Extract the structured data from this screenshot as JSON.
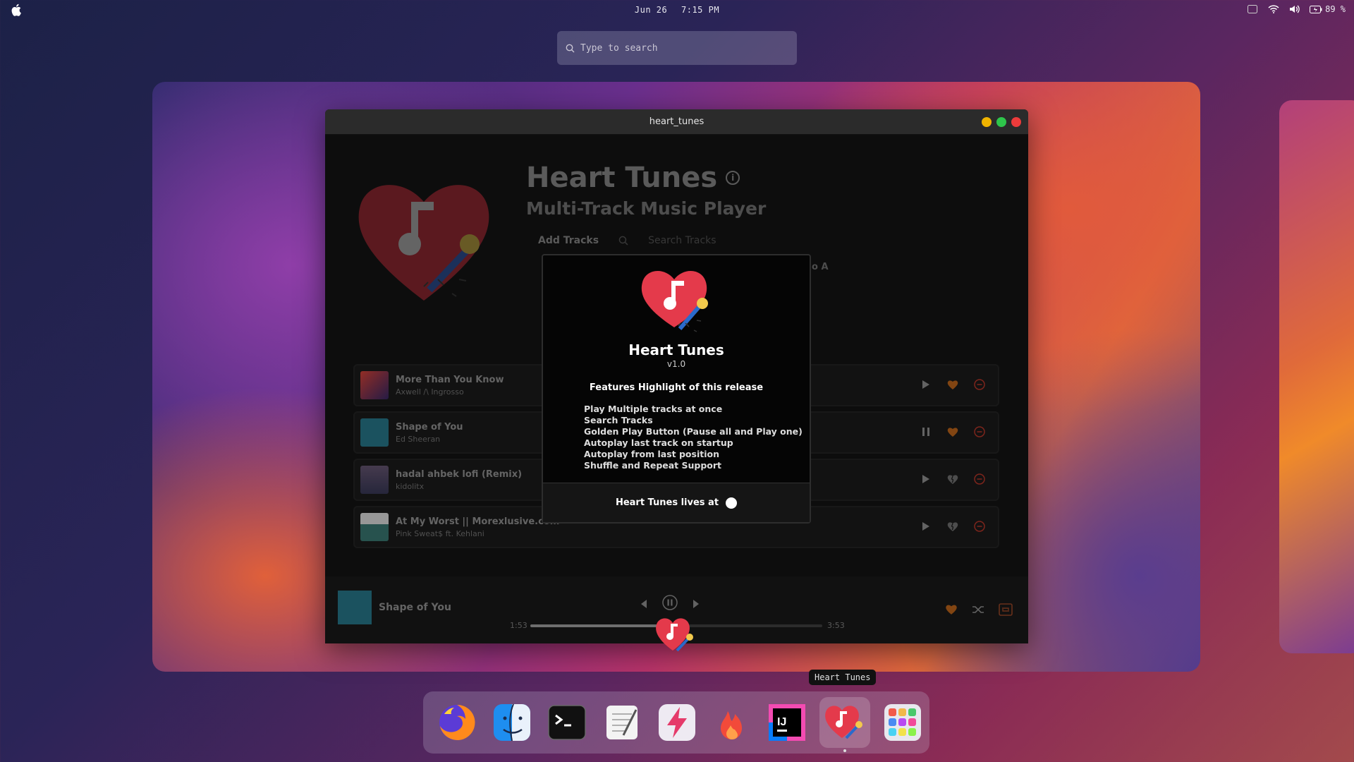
{
  "topbar": {
    "date": "Jun 26",
    "time": "7:15 PM",
    "battery": "89 %"
  },
  "search": {
    "placeholder": "Type to search"
  },
  "window": {
    "title": "heart_tunes",
    "buttons": {
      "minimize": "#f0b400",
      "maximize": "#2ec54b",
      "close": "#ec3b3b"
    }
  },
  "app": {
    "title": "Heart Tunes",
    "subtitle": "Multi-Track Music Player",
    "add_tracks": "Add Tracks",
    "search_placeholder": "Search Tracks",
    "sort_fragment": "o A"
  },
  "tracks": [
    {
      "title": "More Than You Know",
      "artist": "Axwell /\\ Ingrosso",
      "state": "play",
      "liked": true,
      "thumb_color": "#c14a3a"
    },
    {
      "title": "Shape of You",
      "artist": "Ed Sheeran",
      "state": "pause",
      "liked": true,
      "thumb_color": "#2a7f93"
    },
    {
      "title": "hadal ahbek lofi (Remix)",
      "artist": "kidolitx",
      "state": "play",
      "liked": false,
      "thumb_color": "#6b5a78"
    },
    {
      "title": "At My Worst || Morexlusive.com",
      "artist": "Pink Sweat$ ft. Kehlani",
      "state": "play",
      "liked": false,
      "thumb_color": "#3c7e78"
    }
  ],
  "player": {
    "title": "Shape of You",
    "elapsed": "1:53",
    "total": "3:53",
    "progress": 0.485
  },
  "modal": {
    "title": "Heart Tunes",
    "version": "v1.0",
    "features_heading": "Features Highlight of this release",
    "features": [
      "Play Multiple tracks at once",
      "Search Tracks",
      "Golden Play Button (Pause all and Play one)",
      "Autoplay last track on startup",
      "Autoplay from last position",
      "Shuffle and Repeat Support"
    ],
    "footer": "Heart Tunes lives at"
  },
  "dock": {
    "tooltip": "Heart Tunes",
    "items": [
      "firefox-icon",
      "finder-icon",
      "terminal-icon",
      "text-editor-icon",
      "bolt-app-icon",
      "flame-app-icon",
      "intellij-icon",
      "heart-tunes-icon",
      "launchpad-icon"
    ]
  },
  "colors": {
    "accent_heart": "#e43a4b",
    "like_orange": "#c86b1c",
    "remove_red": "#c0392b"
  }
}
